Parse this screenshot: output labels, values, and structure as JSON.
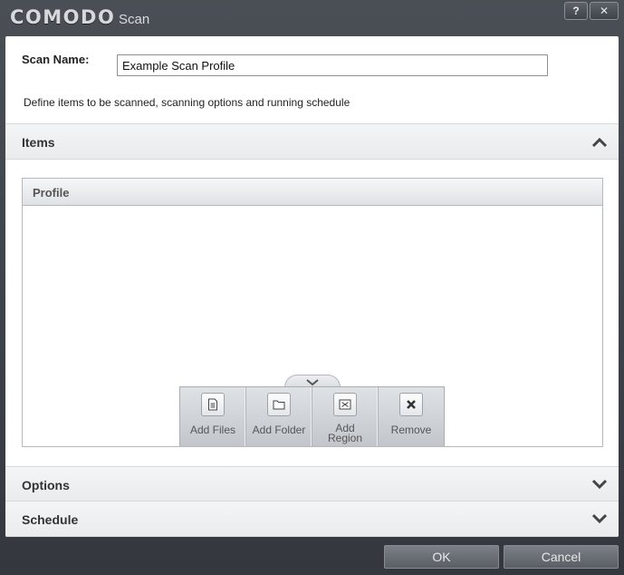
{
  "window": {
    "brand": "COMODO",
    "subtitle": "Scan",
    "help_label": "?",
    "close_label": "✕"
  },
  "form": {
    "scan_name_label": "Scan Name:",
    "scan_name_value": "Example Scan Profile",
    "description": "Define items to be scanned, scanning options and running schedule"
  },
  "sections": {
    "items": "Items",
    "options": "Options",
    "schedule": "Schedule"
  },
  "profile": {
    "header": "Profile"
  },
  "toolbar": {
    "add_files": "Add Files",
    "add_folder": "Add Folder",
    "add_region_line1": "Add",
    "add_region_line2": "Region",
    "remove": "Remove"
  },
  "footer": {
    "ok": "OK",
    "cancel": "Cancel"
  }
}
